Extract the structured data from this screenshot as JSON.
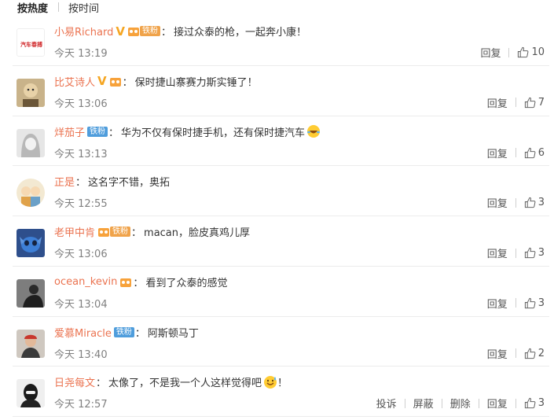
{
  "tabs": [
    {
      "label": "按热度",
      "active": true
    },
    {
      "label": "按时间",
      "active": false
    }
  ],
  "actions": {
    "report": "投诉",
    "block": "屏蔽",
    "delete": "删除",
    "reply": "回复"
  },
  "colors": {
    "name": "#eb7350",
    "iron_fan_orange": "#f0a34a",
    "iron_fan_blue": "#4f9ddc",
    "verified": "#f5a623",
    "time": "#808080"
  },
  "comments": [
    {
      "name": "小易Richard",
      "colon": "：",
      "text": "接过众泰的枪，一起奔小康！",
      "time": "今天 13:19",
      "likes": "10",
      "avatar_text": "汽车春搏",
      "avatar_icon": "car-media-logo-icon",
      "verified": "V",
      "fan_label": "铁粉"
    },
    {
      "name": "比艾诗人",
      "colon": "：",
      "text": "保时捷山寨赛力斯实锤了！",
      "time": "今天 13:06",
      "likes": "7",
      "avatar_icon": "cartoon-avatar-icon",
      "verified": "V"
    },
    {
      "name": "烊茄子",
      "colon": "：",
      "text": "华为不仅有保时捷手机，还有保时捷汽车",
      "time": "今天 13:13",
      "likes": "6",
      "avatar_icon": "anime-girl-avatar-icon",
      "fan_label": "铁粉",
      "emoji": "laughing-emoji-icon"
    },
    {
      "name": "正是",
      "colon": "：",
      "text": "这名字不错，奥拓",
      "time": "今天 12:55",
      "likes": "3",
      "avatar_icon": "cartoon-couple-avatar-icon"
    },
    {
      "name": "老甲中肯",
      "colon": "：",
      "text": "macan，脸皮真鸡儿厚",
      "time": "今天 13:06",
      "likes": "3",
      "avatar_icon": "stitch-avatar-icon",
      "fan_label": "铁粉"
    },
    {
      "name": "ocean_kevin",
      "colon": "：",
      "text": "看到了众泰的感觉",
      "time": "今天 13:04",
      "likes": "3",
      "avatar_icon": "person-photo-avatar-icon"
    },
    {
      "name": "爱慕Miracle",
      "colon": "：",
      "text": "阿斯顿马丁",
      "time": "今天 13:40",
      "likes": "2",
      "avatar_icon": "person-red-hat-avatar-icon",
      "fan_label": "铁粉"
    },
    {
      "name": "日尧每文",
      "colon": "：",
      "text": "太像了，不是我一个人这样觉得吧",
      "text_after": "！",
      "time": "今天 12:57",
      "likes": "3",
      "avatar_icon": "masked-person-avatar-icon",
      "emoji": "sweat-smile-emoji-icon",
      "own": true
    }
  ]
}
